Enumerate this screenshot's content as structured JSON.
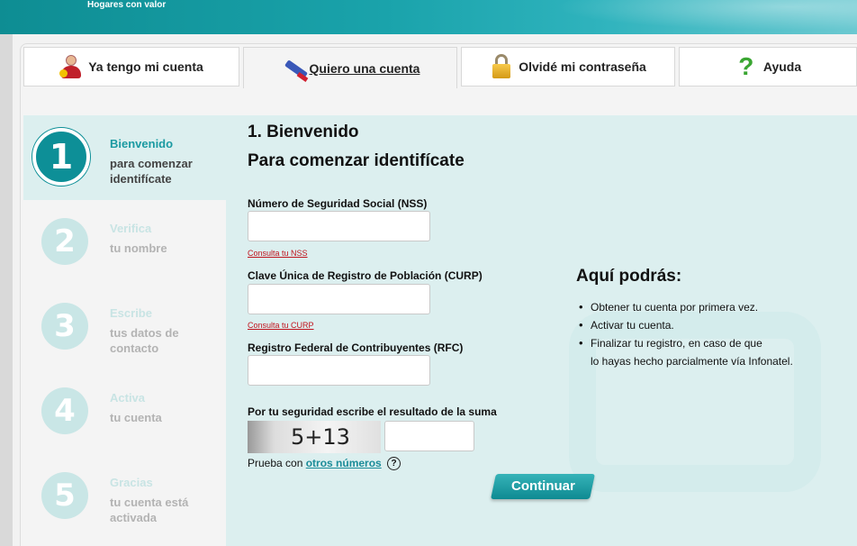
{
  "header": {
    "tagline": "Hogares con valor"
  },
  "tabs": [
    {
      "label": "Ya tengo mi cuenta",
      "icon": "user-icon"
    },
    {
      "label": "Quiero una cuenta",
      "icon": "pencil-icon",
      "active": true
    },
    {
      "label": "Olvidé mi contraseña",
      "icon": "lock-icon"
    },
    {
      "label": "Ayuda",
      "icon": "question-icon"
    }
  ],
  "steps": [
    {
      "number": "1",
      "title": "Bienvenido",
      "subtitle": "para comenzar identifícate",
      "active": true
    },
    {
      "number": "2",
      "title": "Verifica",
      "subtitle": "tu nombre"
    },
    {
      "number": "3",
      "title": "Escribe",
      "subtitle": "tus datos de contacto"
    },
    {
      "number": "4",
      "title": "Activa",
      "subtitle": "tu cuenta"
    },
    {
      "number": "5",
      "title": "Gracias",
      "subtitle": "tu cuenta está activada"
    }
  ],
  "form": {
    "heading": "1. Bienvenido",
    "subheading": "Para comenzar identifícate",
    "nss_label": "Número de Seguridad Social (NSS)",
    "nss_value": "",
    "nss_link": "Consulta tu NSS",
    "curp_label": "Clave Única de Registro de Población (CURP)",
    "curp_value": "",
    "curp_link": "Consulta tu CURP",
    "rfc_label": "Registro Federal de Contribuyentes (RFC)",
    "rfc_value": "",
    "captcha_label": "Por tu seguridad escribe el resultado de la suma",
    "captcha_text": "5+13",
    "captcha_value": "",
    "retry_prefix": "Prueba con ",
    "retry_link": "otros números",
    "help_glyph": "?",
    "continue_label": "Continuar"
  },
  "info": {
    "title": "Aquí podrás:",
    "items": [
      "Obtener tu cuenta por primera vez.",
      "Activar tu cuenta.",
      "Finalizar tu registro, en caso de que"
    ],
    "continuation": "lo hayas hecho parcialmente vía Infonatel."
  },
  "colors": {
    "accent": "#0d8f97",
    "link_red": "#c0141e",
    "panel_bg": "#dcefef"
  }
}
